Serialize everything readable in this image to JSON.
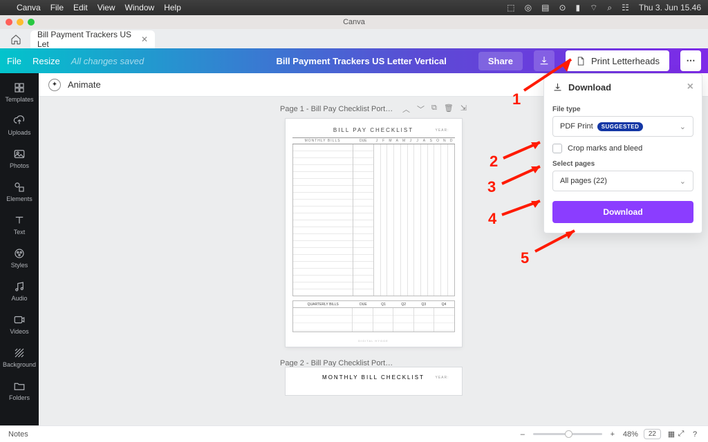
{
  "mac_menu": {
    "items": [
      "Canva",
      "File",
      "Edit",
      "View",
      "Window",
      "Help"
    ],
    "clock": "Thu 3. Jun  15.46"
  },
  "window_title": "Canva",
  "tab": {
    "label": "Bill Payment Trackers US Let"
  },
  "header": {
    "file": "File",
    "resize": "Resize",
    "saved": "All changes saved",
    "doc_title": "Bill Payment Trackers US Letter Vertical",
    "share": "Share",
    "print": "Print Letterheads"
  },
  "leftbar": [
    {
      "label": "Templates"
    },
    {
      "label": "Uploads"
    },
    {
      "label": "Photos"
    },
    {
      "label": "Elements"
    },
    {
      "label": "Text"
    },
    {
      "label": "Styles"
    },
    {
      "label": "Audio"
    },
    {
      "label": "Videos"
    },
    {
      "label": "Background"
    },
    {
      "label": "Folders"
    }
  ],
  "topstrip": {
    "animate": "Animate"
  },
  "page1": {
    "header": "Page 1 - Bill Pay Checklist Port…",
    "title": "BILL PAY CHECKLIST",
    "year_label": "YEAR:",
    "monthly": "MONTHLY BILLS",
    "due": "DUE",
    "months": [
      "J",
      "F",
      "M",
      "A",
      "M",
      "J",
      "J",
      "A",
      "S",
      "O",
      "N",
      "D"
    ],
    "quarterly": "QUARTERLY BILLS",
    "q": [
      "Q1",
      "Q2",
      "Q3",
      "Q4"
    ],
    "footer": "DIGITAL HYGGE"
  },
  "page2": {
    "header": "Page 2 - Bill Pay Checklist Port…",
    "title": "MONTHLY BILL CHECKLIST",
    "year_label": "YEAR:"
  },
  "download_panel": {
    "title": "Download",
    "file_type_label": "File type",
    "file_type_value": "PDF Print",
    "file_type_badge": "SUGGESTED",
    "crop": "Crop marks and bleed",
    "select_pages_label": "Select pages",
    "select_pages_value": "All pages (22)",
    "button": "Download"
  },
  "bottom": {
    "notes": "Notes",
    "zoom": "48%",
    "pages": "22"
  },
  "annotations": {
    "n1": "1",
    "n2": "2",
    "n3": "3",
    "n4": "4",
    "n5": "5"
  }
}
